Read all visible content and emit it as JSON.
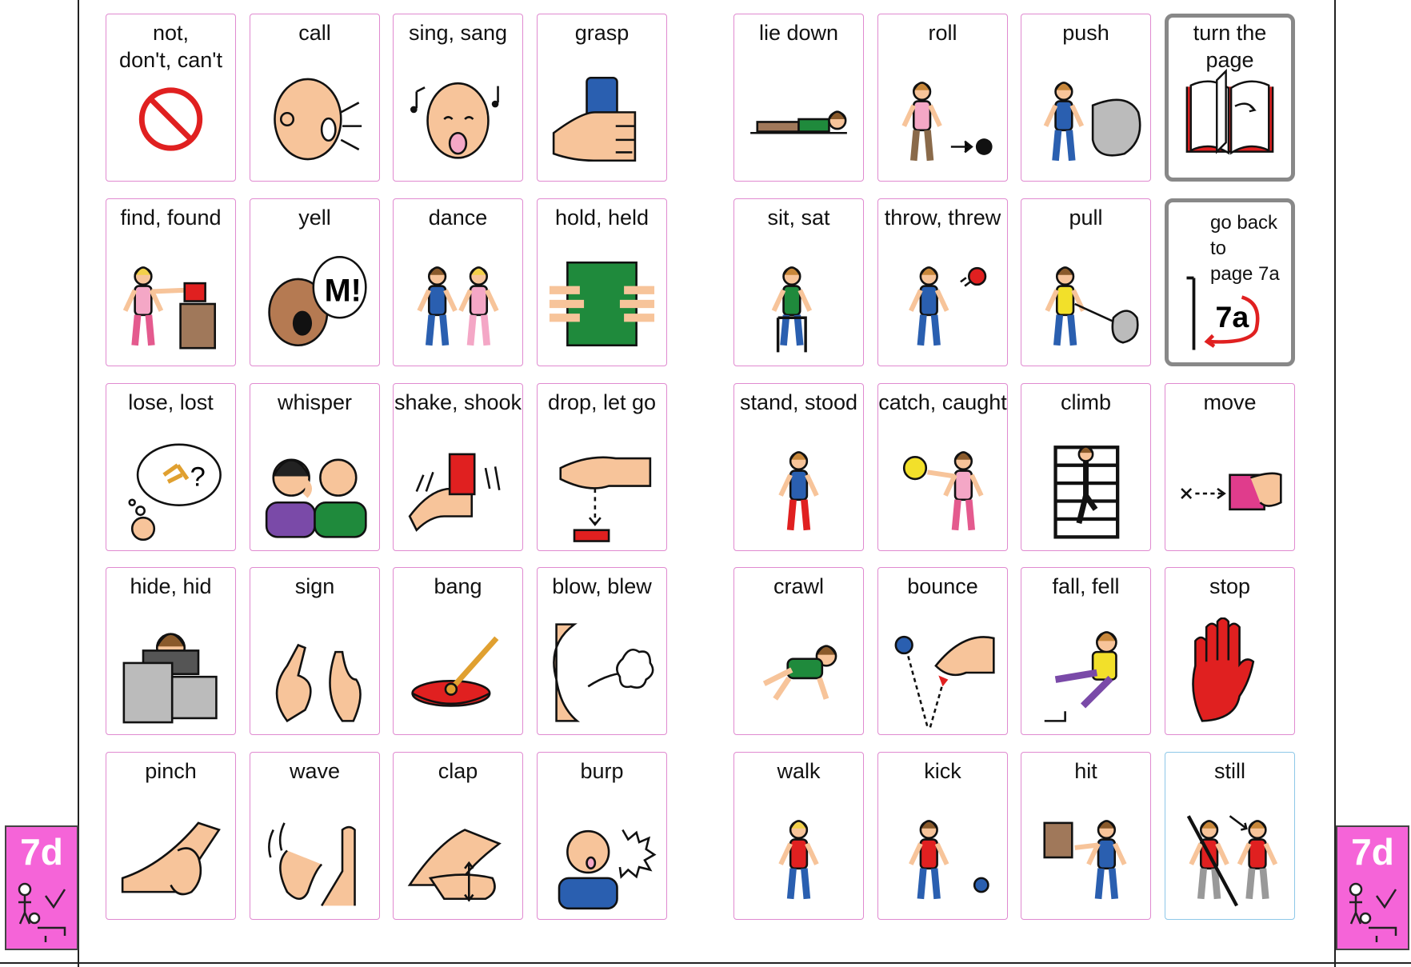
{
  "page_tab": "7d",
  "nav": {
    "go_back_text": "go back to\npage 7a",
    "go_back_target": "7a"
  },
  "cells": [
    {
      "label": "not,\ndon't, can't",
      "icon": "no-sign-icon"
    },
    {
      "label": "call",
      "icon": "call-icon"
    },
    {
      "label": "sing,  sang",
      "icon": "sing-icon"
    },
    {
      "label": "grasp",
      "icon": "grasp-icon"
    },
    {
      "label": "lie down",
      "icon": "lie-down-icon"
    },
    {
      "label": "roll",
      "icon": "roll-icon"
    },
    {
      "label": "push",
      "icon": "push-icon"
    },
    {
      "label": "turn the page",
      "icon": "book-icon"
    },
    {
      "label": "find, found",
      "icon": "find-icon"
    },
    {
      "label": "yell",
      "icon": "yell-icon"
    },
    {
      "label": "dance",
      "icon": "dance-icon"
    },
    {
      "label": "hold,  held",
      "icon": "hold-icon"
    },
    {
      "label": "sit,  sat",
      "icon": "sit-icon"
    },
    {
      "label": "throw,  threw",
      "icon": "throw-icon"
    },
    {
      "label": "pull",
      "icon": "pull-icon"
    },
    {
      "label": "",
      "icon": "go-back-icon"
    },
    {
      "label": "lose, lost",
      "icon": "lose-icon"
    },
    {
      "label": "whisper",
      "icon": "whisper-icon"
    },
    {
      "label": "shake,  shook",
      "icon": "shake-icon"
    },
    {
      "label": "drop, let go",
      "icon": "drop-icon"
    },
    {
      "label": "stand,  stood",
      "icon": "stand-icon"
    },
    {
      "label": "catch,  caught",
      "icon": "catch-icon"
    },
    {
      "label": "climb",
      "icon": "climb-icon"
    },
    {
      "label": "move",
      "icon": "move-icon"
    },
    {
      "label": "hide, hid",
      "icon": "hide-icon"
    },
    {
      "label": "sign",
      "icon": "sign-icon"
    },
    {
      "label": "bang",
      "icon": "drum-icon"
    },
    {
      "label": "blow, blew",
      "icon": "blow-icon"
    },
    {
      "label": "crawl",
      "icon": "crawl-icon"
    },
    {
      "label": "bounce",
      "icon": "bounce-icon"
    },
    {
      "label": "fall,  fell",
      "icon": "fall-icon"
    },
    {
      "label": "stop",
      "icon": "stop-hand-icon"
    },
    {
      "label": "pinch",
      "icon": "pinch-icon"
    },
    {
      "label": "wave",
      "icon": "wave-icon"
    },
    {
      "label": "clap",
      "icon": "clap-icon"
    },
    {
      "label": "burp",
      "icon": "burp-icon"
    },
    {
      "label": "walk",
      "icon": "walk-icon"
    },
    {
      "label": "kick",
      "icon": "kick-icon"
    },
    {
      "label": "hit",
      "icon": "hit-icon"
    },
    {
      "label": "still",
      "icon": "still-icon"
    }
  ],
  "colors": {
    "cell_border": "#e08ad0",
    "nav_border": "#888888",
    "tab_bg": "#f564d8",
    "skin": "#f7c49a",
    "red": "#e02020",
    "blue": "#2a5fb0",
    "green": "#1f8a3c"
  }
}
